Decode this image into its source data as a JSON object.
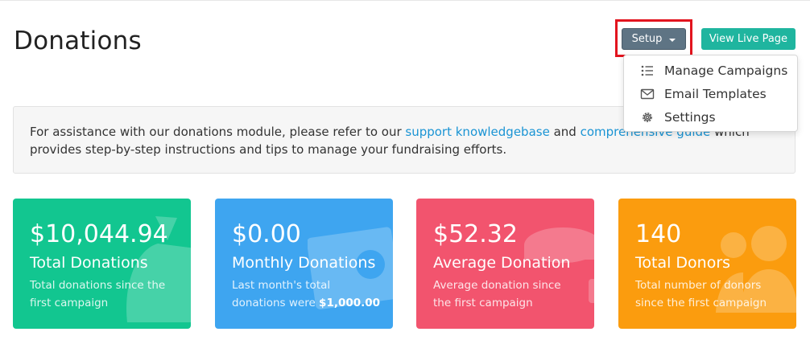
{
  "header": {
    "title": "Donations",
    "setup_label": "Setup",
    "view_live_label": "View Live Page"
  },
  "setup_menu": {
    "items": [
      {
        "label": "Manage Campaigns",
        "icon": "list-icon"
      },
      {
        "label": "Email Templates",
        "icon": "envelope-icon"
      },
      {
        "label": "Settings",
        "icon": "gear-icon"
      }
    ]
  },
  "info": {
    "text_before": "For assistance with our donations module, please refer to our ",
    "link1": "support knowledgebase",
    "text_middle": " and ",
    "link2": "comprehensive guide",
    "text_after": " which provides step-by-step instructions and tips to manage your fundraising efforts."
  },
  "cards": [
    {
      "value": "$10,044.94",
      "title": "Total Donations",
      "desc": "Total donations since the first campaign",
      "color": "#12c690",
      "icon": "money-bag-icon"
    },
    {
      "value": "$0.00",
      "title": "Monthly Donations",
      "desc": "Last month's total donations were ",
      "desc_bold": "$1,000.00",
      "color": "#3ea5f0",
      "icon": "banknote-icon"
    },
    {
      "value": "$52.32",
      "title": "Average Donation",
      "desc": "Average donation since the first campaign",
      "color": "#f2546e",
      "icon": "coins-icon"
    },
    {
      "value": "140",
      "title": "Total Donors",
      "desc": "Total number of donors since the first campaign",
      "color": "#fb9c0e",
      "icon": "users-icon"
    }
  ]
}
